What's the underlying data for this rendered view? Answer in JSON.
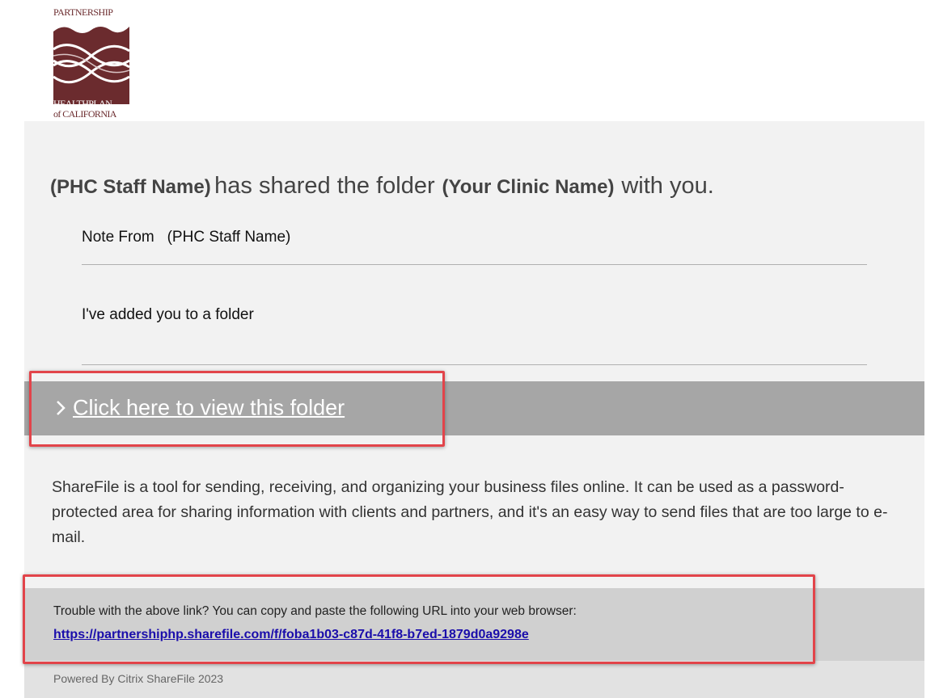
{
  "logo": {
    "top_text": "PARTNERSHIP",
    "bottom_line1": "HEALTHPLAN",
    "bottom_line2": "of CALIFORNIA",
    "brand_color": "#6b2b2e"
  },
  "headline": {
    "sender": "(PHC Staff Name)",
    "action": "has shared the folder",
    "folder": "(Your Clinic Name)",
    "suffix": "with you."
  },
  "note": {
    "label": "Note From",
    "sender": "(PHC Staff Name)",
    "message": "I've added you to a folder"
  },
  "view_link": {
    "icon": "chevron-right-icon",
    "label": "Click here to view this folder"
  },
  "description": "ShareFile is a tool for sending, receiving, and organizing your business files online. It can be used as a password-protected area for sharing information with clients and partners, and it's an easy way to send files that are too large to e-mail.",
  "trouble": {
    "text": "Trouble with the above link? You can copy and paste the following URL into your web browser:",
    "url": "https://partnershiphp.sharefile.com/f/foba1b03-c87d-41f8-b7ed-1879d0a9298e"
  },
  "footer": {
    "powered_by": "Powered By Citrix ShareFile 2023"
  },
  "colors": {
    "highlight": "#e2444a",
    "link": "#1a0dab",
    "view_bar": "#a6a6a6"
  }
}
